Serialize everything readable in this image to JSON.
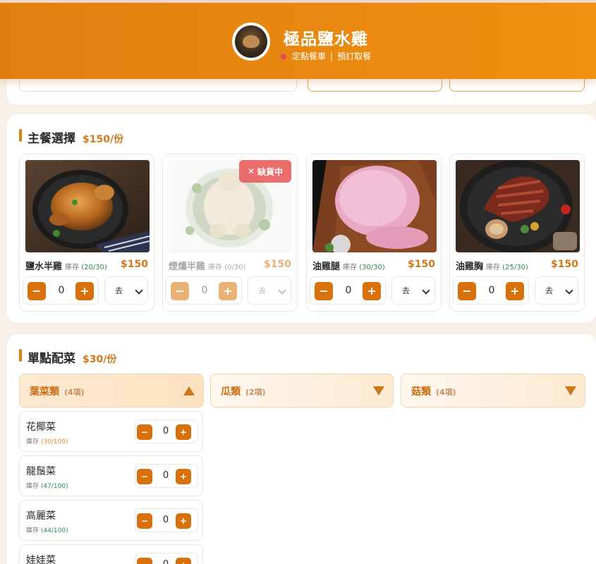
{
  "header": {
    "title": "極品鹽水雞",
    "subtitle_order": "定點餐車",
    "subtitle_sep": "|",
    "subtitle_pickup": "預訂取餐"
  },
  "main_section": {
    "title": "主餐選擇",
    "price_label": "$150/份",
    "products": [
      {
        "name": "鹽水半雞",
        "stock_label": "庫存",
        "stock": "(20/30)",
        "price": "$150",
        "quantity": "0",
        "option": "去骨",
        "available": true
      },
      {
        "name": "煙燻半雞",
        "stock_label": "庫存",
        "stock": "(0/30)",
        "price": "$150",
        "quantity": "0",
        "option": "去骨",
        "available": false,
        "badge": "缺貨中"
      },
      {
        "name": "油雞腿",
        "stock_label": "庫存",
        "stock": "(30/30)",
        "price": "$150",
        "quantity": "0",
        "option": "去骨",
        "available": true
      },
      {
        "name": "油雞胸",
        "stock_label": "庫存",
        "stock": "(25/30)",
        "price": "$150",
        "quantity": "0",
        "option": "去骨",
        "available": true
      }
    ]
  },
  "side_section": {
    "title": "單點配菜",
    "price_label": "$30/份",
    "categories": [
      {
        "name": "葉菜類",
        "count": "(4項)",
        "expanded": true
      },
      {
        "name": "瓜類",
        "count": "(2項)",
        "expanded": false
      },
      {
        "name": "菇類",
        "count": "(4項)",
        "expanded": false
      }
    ],
    "items": [
      {
        "name": "花椰菜",
        "stock_label": "庫存",
        "stock": "(30/100)",
        "stock_color": "#d98a2c",
        "quantity": "0"
      },
      {
        "name": "龍鬚菜",
        "stock_label": "庫存",
        "stock": "(47/100)",
        "stock_color": "#2f8a4a",
        "quantity": "0"
      },
      {
        "name": "高麗菜",
        "stock_label": "庫存",
        "stock": "(44/100)",
        "stock_color": "#2f8a4a",
        "quantity": "0"
      },
      {
        "name": "娃娃菜",
        "stock_label": "庫存",
        "stock": "",
        "stock_color": "#2f8a4a",
        "quantity": "0"
      }
    ]
  },
  "controls": {
    "minus": "−",
    "plus": "+",
    "close": "✕"
  },
  "colors": {
    "accent": "#e07f10",
    "button": "#d8700c",
    "price": "#d2761a",
    "stock_ok": "#2f8a4a"
  }
}
